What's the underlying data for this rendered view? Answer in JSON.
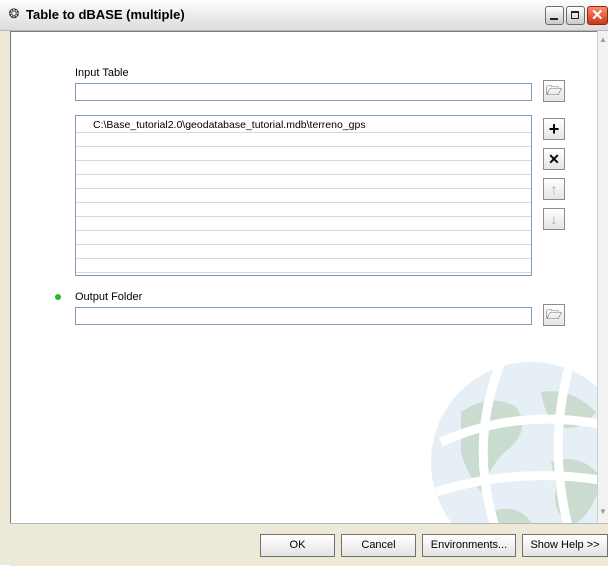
{
  "window": {
    "title": "Table to dBASE (multiple)",
    "app_icon": "hammer-icon",
    "controls": {
      "minimize_icon": "minimize-icon",
      "maximize_icon": "maximize-icon",
      "close_icon": "close-icon"
    }
  },
  "form": {
    "input_table": {
      "label": "Input Table",
      "value": "",
      "browse_icon": "folder-open-icon"
    },
    "table_list": {
      "items": [
        "C:\\Base_tutorial2.0\\geodatabase_tutorial.mdb\\terreno_gps"
      ],
      "buttons": [
        {
          "name": "add",
          "icon": "plus-icon",
          "glyph": "+",
          "enabled": true
        },
        {
          "name": "remove",
          "icon": "x-icon",
          "glyph": "✕",
          "enabled": true
        },
        {
          "name": "move-up",
          "icon": "arrow-up-icon",
          "glyph": "↑",
          "enabled": false
        },
        {
          "name": "move-down",
          "icon": "arrow-down-icon",
          "glyph": "↓",
          "enabled": false
        }
      ]
    },
    "output_folder": {
      "label": "Output Folder",
      "value": "",
      "browse_icon": "folder-open-icon",
      "required_indicator_color": "#2fb52f"
    }
  },
  "buttons": {
    "ok": "OK",
    "cancel": "Cancel",
    "environments": "Environments...",
    "show_help": "Show Help >>"
  }
}
